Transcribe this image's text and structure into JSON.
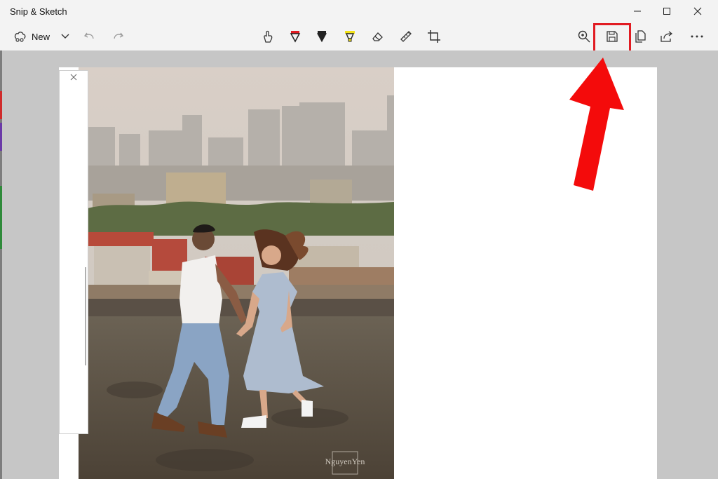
{
  "window": {
    "title": "Snip & Sketch",
    "controls": [
      "minimize-icon",
      "maximize-icon",
      "close-icon"
    ]
  },
  "toolbar": {
    "new_label": "New",
    "left_icons": [
      "new-snip-icon",
      "chevron-down-icon",
      "undo-icon",
      "redo-icon"
    ],
    "center_tools": [
      "touch-writing-icon",
      "ballpoint-pen-icon",
      "pencil-icon",
      "highlighter-icon",
      "eraser-icon",
      "ruler-icon",
      "crop-icon"
    ],
    "right_tools": [
      "zoom-icon",
      "save-icon",
      "copy-icon",
      "share-icon",
      "more-icon"
    ],
    "pen_color": "#e11b22",
    "highlighter_color": "#f2e21a",
    "selected_tool": "ballpoint-pen"
  },
  "annotation": {
    "highlight_target": "save-icon",
    "arrow_color": "#f40b0b",
    "highlight_color": "#e11b22"
  },
  "sidebar_colors": [
    "#d02b2b",
    "#6b3aa8",
    "#2f8a3a",
    "#c4c4c4"
  ],
  "photo": {
    "watermark_text": "NguyenYen"
  }
}
